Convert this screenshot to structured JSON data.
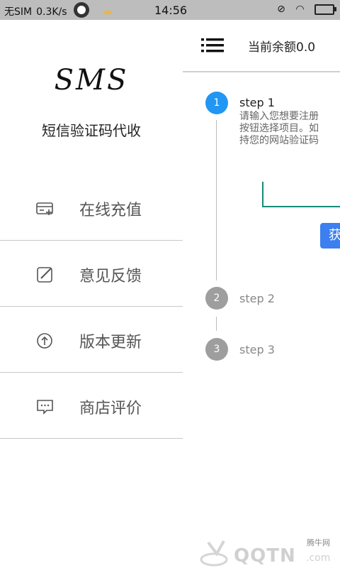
{
  "status_bar": {
    "carrier": "无SIM",
    "speed": "0.3K/s",
    "time": "14:56"
  },
  "drawer": {
    "logo": "SMS",
    "subtitle": "短信验证码代收",
    "items": [
      {
        "label": "在线充值",
        "icon": "card-plus-icon"
      },
      {
        "label": "意见反馈",
        "icon": "edit-icon"
      },
      {
        "label": "版本更新",
        "icon": "up-arrow-circle-icon"
      },
      {
        "label": "商店评价",
        "icon": "chat-bubble-icon"
      }
    ]
  },
  "main": {
    "balance": "当前余额0.0",
    "steps": [
      {
        "number": "1",
        "title": "step 1",
        "active": true
      },
      {
        "number": "2",
        "title": "step 2",
        "active": false
      },
      {
        "number": "3",
        "title": "step 3",
        "active": false
      }
    ],
    "step1_desc_lines": [
      "请输入您想要注册",
      "按钮选择项目。如",
      "持您的网站验证码"
    ],
    "get_button": "获"
  },
  "watermark": {
    "small": "腾牛网",
    "big": "QQTN",
    "dotcom": ".com"
  },
  "colors": {
    "accent": "#2196f3",
    "inactive": "#9e9e9e",
    "input_line": "#188a7a",
    "button": "#3b7ff0"
  }
}
